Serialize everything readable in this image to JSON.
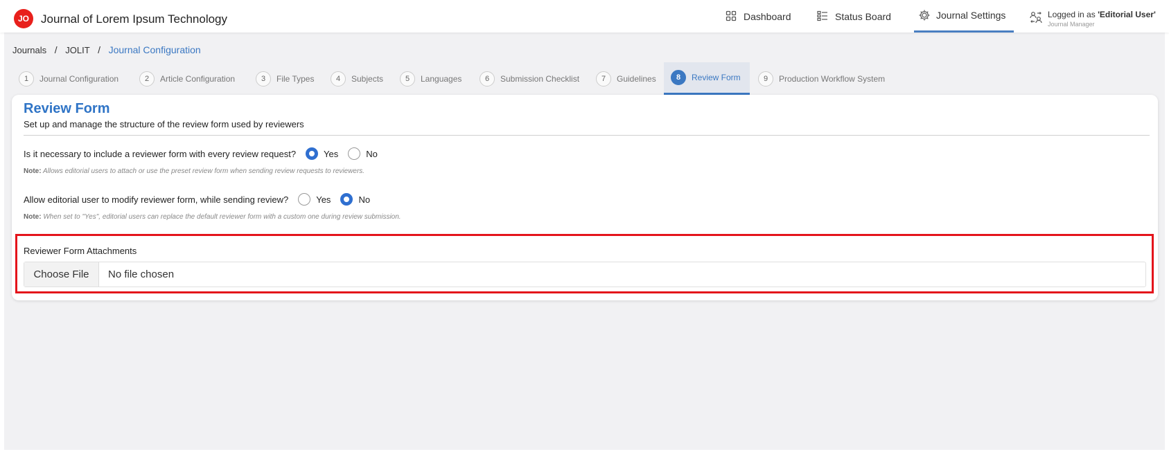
{
  "app": {
    "logo_text": "JO",
    "title": "Journal of Lorem Ipsum Technology",
    "brand_color": "#e8201c"
  },
  "nav": {
    "items": [
      {
        "label": "Dashboard",
        "icon": "grid-icon"
      },
      {
        "label": "Status Board",
        "icon": "board-icon"
      },
      {
        "label": "Journal Settings",
        "icon": "gear-icon",
        "active": true
      }
    ],
    "user": {
      "prefix": "Logged in as ",
      "name": "'Editorial User'",
      "role": "Journal Manager",
      "icon": "user-switch-icon"
    }
  },
  "breadcrumb": {
    "items": [
      "Journals",
      "JOLIT"
    ],
    "separator": "/",
    "current": "Journal Configuration"
  },
  "steps": [
    {
      "num": "1",
      "label": "Journal Configuration"
    },
    {
      "num": "2",
      "label": "Article Configuration"
    },
    {
      "num": "3",
      "label": "File Types"
    },
    {
      "num": "4",
      "label": "Subjects"
    },
    {
      "num": "5",
      "label": "Languages"
    },
    {
      "num": "6",
      "label": "Submission Checklist"
    },
    {
      "num": "7",
      "label": "Guidelines"
    },
    {
      "num": "8",
      "label": "Review Form",
      "active": true
    },
    {
      "num": "9",
      "label": "Production Workflow System"
    }
  ],
  "card": {
    "title": "Review Form",
    "subtitle": "Set up and manage the structure of the review form used by reviewers",
    "q1": {
      "text": "Is it necessary to include a reviewer form with every review request?",
      "yes": "Yes",
      "no": "No",
      "selected": "Yes",
      "note_label": "Note:",
      "note": "Allows editorial users to attach or use the preset review form when sending review requests to reviewers."
    },
    "q2": {
      "text": "Allow editorial user to modify reviewer form, while sending review?",
      "yes": "Yes",
      "no": "No",
      "selected": "No",
      "note_label": "Note:",
      "note": "When set to \"Yes\", editorial users can replace the default reviewer form with a custom one during review submission."
    },
    "attachments": {
      "label": "Reviewer Form Attachments",
      "button": "Choose File",
      "status": "No file chosen",
      "highlight_color": "#e4141b"
    }
  },
  "accent_color": "#3b78c2"
}
